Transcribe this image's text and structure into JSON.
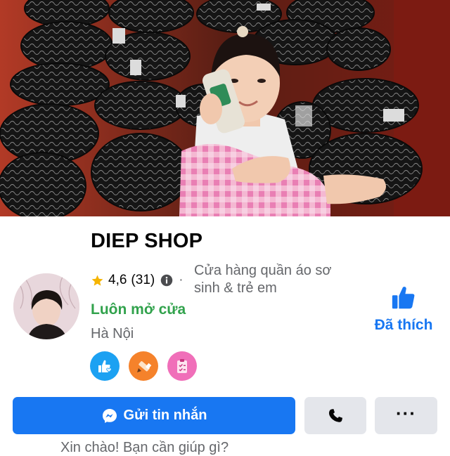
{
  "page": {
    "name": "DIEP SHOP",
    "rating": "4,6",
    "rating_count": "(31)",
    "separator": "·",
    "category": "Cửa hàng quần áo sơ sinh & trẻ em",
    "status": "Luôn mở cửa",
    "location": "Hà Nội"
  },
  "like": {
    "label": "Đã thích"
  },
  "actions": {
    "message_label": "Gửi tin nhắn",
    "more_label": "···"
  },
  "greeting": "Xin chào! Bạn cần giúp gì?",
  "badges": [
    {
      "icon": "responsive-messaging-icon",
      "color": "#1ca1f2"
    },
    {
      "icon": "pencil-icon",
      "color": "#f5822b"
    },
    {
      "icon": "clipboard-icon",
      "color": "#f06fb9"
    }
  ],
  "colors": {
    "brand_blue": "#1877f2",
    "open_green": "#31a24c",
    "secondary_text": "#65676b",
    "button_gray": "#e4e6eb"
  }
}
